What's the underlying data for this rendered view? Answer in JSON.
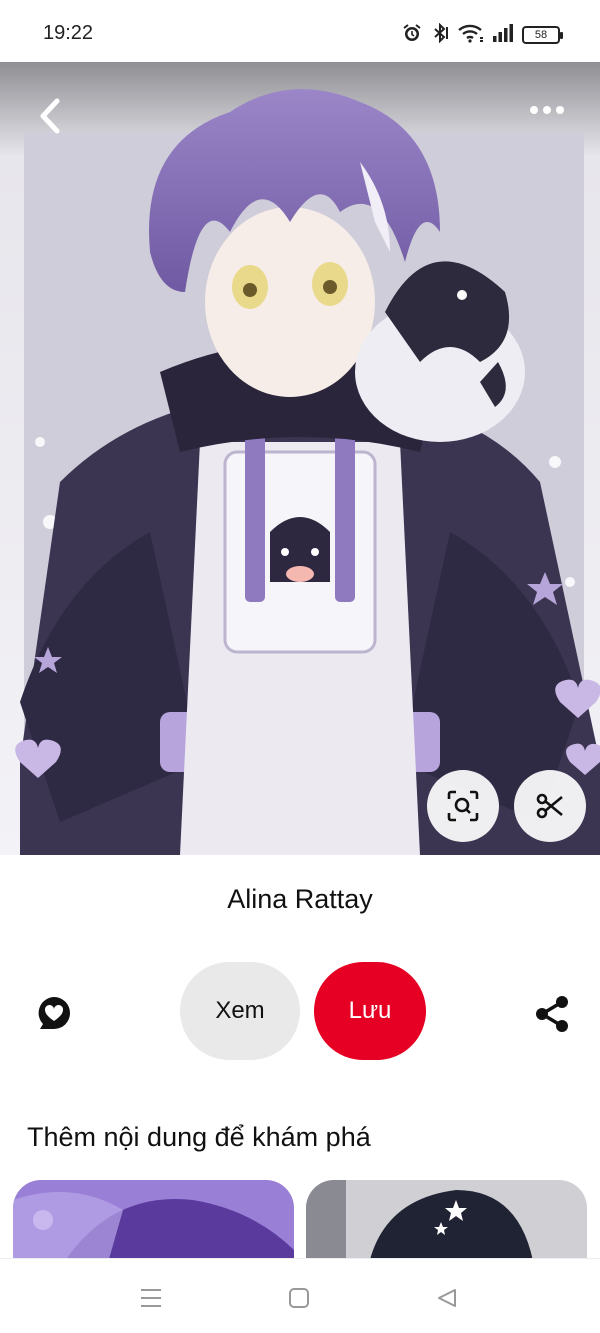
{
  "status_bar": {
    "time": "19:22",
    "battery": "58",
    "icons": [
      "alarm-icon",
      "bluetooth-icon",
      "wifi-icon",
      "signal-icon",
      "battery-icon"
    ]
  },
  "pin": {
    "image_icon": "anime-boy-with-penguin-illustration",
    "creator": "Alina Rattay"
  },
  "actions": {
    "view_label": "Xem",
    "save_label": "Lưu",
    "comment_icon": "comment-heart-icon",
    "share_icon": "share-icon"
  },
  "more_section": {
    "title": "Thêm nội dung để khám phá"
  },
  "colors": {
    "accent": "#e60023",
    "secondary_button": "#e9e9e9",
    "background": "#ffffff"
  },
  "nav_bar": {
    "icons": [
      "menu-icon",
      "home-icon",
      "back-triangle-icon"
    ]
  }
}
